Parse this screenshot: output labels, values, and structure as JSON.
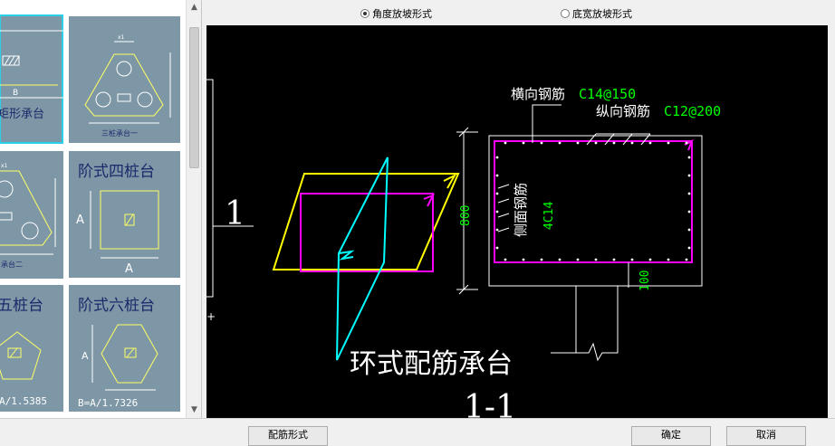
{
  "radios": [
    {
      "label": "角度放坡形式",
      "checked": true
    },
    {
      "label": "底宽放坡形式",
      "checked": false
    }
  ],
  "gallery": {
    "t0_caption": "B",
    "t0_label": "矩形承台",
    "t1_label": "三桩承台一",
    "t1_dim_top": "x1",
    "t2_label": "承台二",
    "t2_dim": "x1",
    "t3_title": "阶式四桩台",
    "t3_dim_side": "A",
    "t3_dim_bottom": "A",
    "t4_title": "五桩台",
    "t4_formula": "A/1.5385",
    "t5_title": "阶式六桩台",
    "t5_dim_side": "A",
    "t5_formula": "B=A/1.7326"
  },
  "drawing": {
    "section_mark": "1",
    "label_heng": "横向钢筋",
    "val_heng": "C14@150",
    "label_zong": "纵向钢筋",
    "val_zong": "C12@200",
    "label_side": "侧面钢筋",
    "val_side": "4C14",
    "dim_height": "800",
    "dim_cover": "100",
    "main_title": "环式配筋承台",
    "section_title": "1-1"
  },
  "buttons": {
    "reinforce": "配筋形式",
    "ok": "确定",
    "cancel": "取消"
  },
  "colors": {
    "thumb_bg": "#7d97a6",
    "cad_bg": "#000000",
    "magenta": "#ff00ff",
    "cyan": "#00ffff",
    "yellow": "#ffff00",
    "green": "#00ff00"
  }
}
